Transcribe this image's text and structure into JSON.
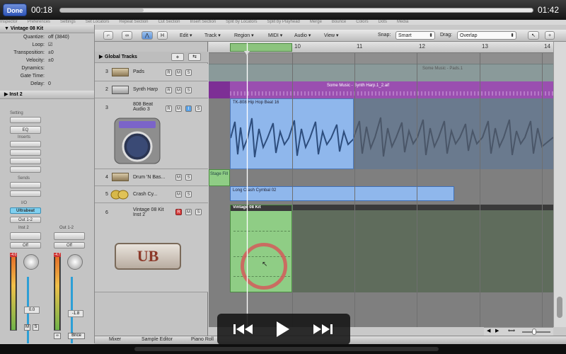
{
  "video": {
    "done_label": "Done",
    "elapsed": "00:18",
    "remaining": "01:42",
    "progress_fraction": 0.176
  },
  "menu_strip": [
    "Inspector",
    "Preferences",
    "Settings",
    "Set Locators",
    "Repeat Section",
    "Cut Section",
    "Insert Section",
    "Split by Locators",
    "Split by Playhead",
    "Merge",
    "Bounce",
    "Colors",
    "Dots",
    "Media"
  ],
  "inspector": {
    "region_header": "Vintage 08 Kit",
    "params": [
      {
        "label": "Quantize:",
        "value": "off (3840)"
      },
      {
        "label": "Loop:",
        "value": "☑"
      },
      {
        "label": "Transposition:",
        "value": "±0"
      },
      {
        "label": "Velocity:",
        "value": "±0"
      },
      {
        "label": "Dynamics:",
        "value": ""
      },
      {
        "label": "Gate Time:",
        "value": ""
      },
      {
        "label": "Delay:",
        "value": "0"
      }
    ],
    "track_header": "Inst 2",
    "setting_label": "Setting",
    "eq_label": "EQ",
    "inserts_label": "Inserts",
    "sends_label": "Sends",
    "io_label": "I/O",
    "instrument_slot": "Ultrabeat",
    "output_slot": "Out 1-2",
    "channel_left_name": "Inst 2",
    "channel_right_name": "Out 1-2",
    "automation_left": "Off",
    "automation_right": "Off",
    "fader_value_left": "0.0",
    "fader_value_right": "-1.8",
    "peak_left": "-4.0",
    "peak_right": "-4.7",
    "bnce_label": "Bnce",
    "ms_m": "M",
    "ms_s": "S"
  },
  "toolbar": {
    "edit": "Edit",
    "track": "Track",
    "region": "Region",
    "midi": "MIDI",
    "audio": "Audio",
    "view": "View",
    "snap_label": "Snap:",
    "snap_value": "Smart",
    "drag_label": "Drag:",
    "drag_value": "Overlap",
    "h_label": "H"
  },
  "global_tracks_label": "Global Tracks",
  "tracks": [
    {
      "num": "3",
      "name": "Pads"
    },
    {
      "num": "2",
      "name": "Synth Harp"
    },
    {
      "num": "3",
      "name": "808 Beat Audio 3"
    },
    {
      "num": "4",
      "name": "Drum 'N Bas..."
    },
    {
      "num": "5",
      "name": "Crash Cy..."
    },
    {
      "num": "6",
      "name": "Vintage 08 Kit Inst 2"
    }
  ],
  "ruler": {
    "bars": [
      "9",
      "10",
      "11",
      "12",
      "13",
      "14"
    ]
  },
  "regions": {
    "pads": "Some Music - Pads.1",
    "synth_harp": "Some Music - Synth Harp.1_2.aif",
    "beat": "TK-808 Hip Hop Beat 16",
    "drum_fill": "Stage Fill",
    "crash": "Long Crash Cymbal 02",
    "vintage": "Vintage 08 Kit"
  },
  "instrument_logo": "UB",
  "bottom_tabs": [
    "Mixer",
    "Sample Editor",
    "Piano Roll"
  ],
  "colors": {
    "cycle": "#8cc47e",
    "beat_region": "#8fb7ec",
    "midi_region": "#8fcd85",
    "synth_region": "#9a4fb0",
    "done_blue": "#3f64c4",
    "rec_red": "#d63c3c"
  }
}
